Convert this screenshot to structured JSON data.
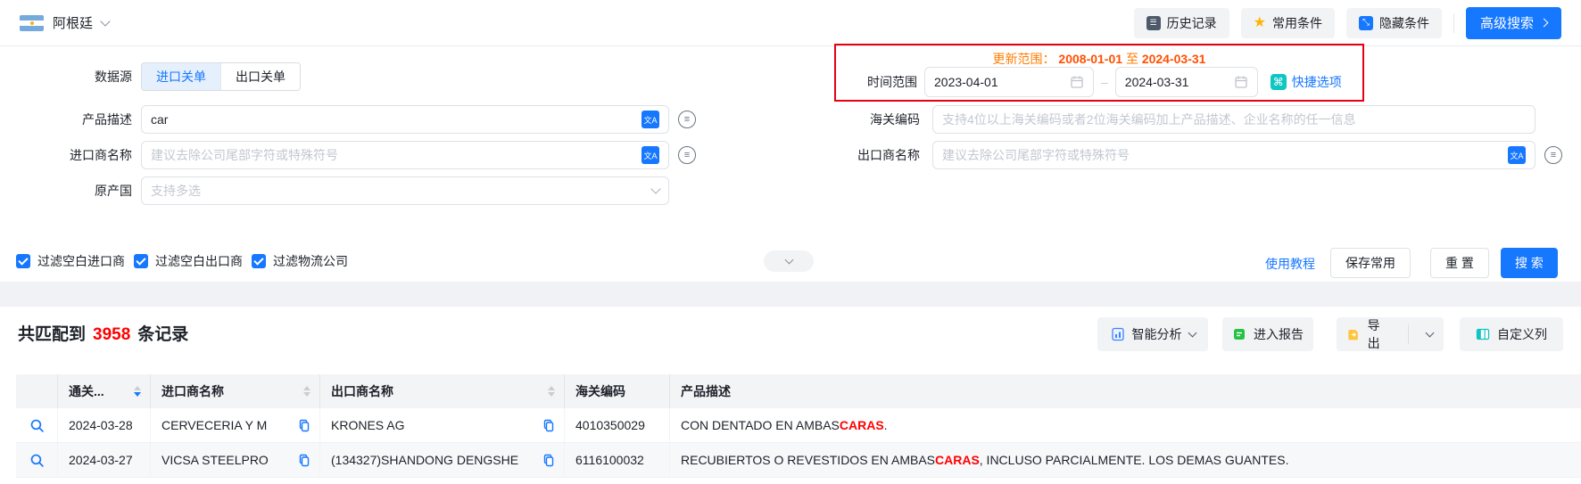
{
  "topbar": {
    "country": "阿根廷",
    "history": "历史记录",
    "favorites": "常用条件",
    "hide": "隐藏条件",
    "advanced": "高级搜索"
  },
  "icons": {
    "history": "☰",
    "star": "★",
    "hide": "⤡",
    "quick": "⌘",
    "translate": "文A",
    "synonym": "≡"
  },
  "form": {
    "datasource_label": "数据源",
    "tabs": {
      "import": "进口关单",
      "export": "出口关单"
    },
    "update_range": {
      "label": "更新范围：",
      "from": "2008-01-01",
      "to_word": "至",
      "to": "2024-03-31"
    },
    "time_range": {
      "label": "时间范围",
      "from": "2023-04-01",
      "dash": "–",
      "to": "2024-03-31",
      "quick": "快捷选项"
    },
    "product": {
      "label": "产品描述",
      "value": "car"
    },
    "hs": {
      "label": "海关编码",
      "placeholder": "支持4位以上海关编码或者2位海关编码加上产品描述、企业名称的任一信息"
    },
    "importer": {
      "label": "进口商名称",
      "placeholder": "建议去除公司尾部字符或特殊符号"
    },
    "exporter": {
      "label": "出口商名称",
      "placeholder": "建议去除公司尾部字符或特殊符号"
    },
    "origin": {
      "label": "原产国",
      "placeholder": "支持多选"
    },
    "filters": [
      "过滤空白进口商",
      "过滤空白出口商",
      "过滤物流公司"
    ],
    "tutorial": "使用教程",
    "save": "保存常用",
    "reset": "重 置",
    "search": "搜 索"
  },
  "results": {
    "count_prefix": "共匹配到",
    "count": "3958",
    "count_suffix": "条记录",
    "analyze": "智能分析",
    "report": "进入报告",
    "export": "导出",
    "customize": "自定义列",
    "table": {
      "headers": {
        "date": "通关...",
        "importer": "进口商名称",
        "exporter": "出口商名称",
        "hs": "海关编码",
        "desc": "产品描述"
      },
      "rows": [
        {
          "date": "2024-03-28",
          "importer": "CERVECERIA Y M",
          "exporter": "KRONES AG",
          "hs": "4010350029",
          "desc_pre": "CON DENTADO EN AMBAS ",
          "desc_hl": "CARAS",
          "desc_post": "."
        },
        {
          "date": "2024-03-27",
          "importer": "VICSA STEELPRO",
          "exporter": "(134327)SHANDONG DENGSHE",
          "hs": "6116100032",
          "desc_pre": "RECUBIERTOS O REVESTIDOS EN AMBAS ",
          "desc_hl": "CARAS",
          "desc_post": ", INCLUSO PARCIALMENTE. LOS DEMAS GUANTES."
        }
      ]
    }
  },
  "colors": {
    "primary": "#1677ff",
    "annotation_red": "#e60012",
    "update_orange": "#ff7d00",
    "highlight_red": "#ff0000"
  }
}
